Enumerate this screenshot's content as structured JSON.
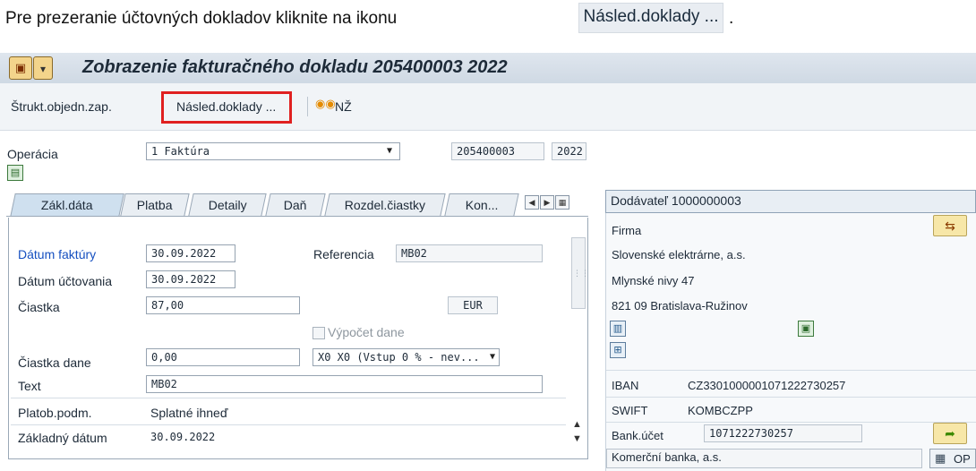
{
  "instruction": {
    "text": "Pre prezeranie účtovných dokladov kliknite na ikonu",
    "button_label": "Násled.doklady ...",
    "end": "."
  },
  "window": {
    "title": "Zobrazenie fakturačného dokladu 205400003 2022"
  },
  "toolbar": {
    "structure_label": "Štrukt.objedn.zap.",
    "follow_on_label": "Násled.doklady ...",
    "nz_label": "NŽ"
  },
  "header": {
    "operation_label": "Operácia",
    "operation_value": "1 Faktúra",
    "doc_number": "205400003",
    "year": "2022"
  },
  "tabs": [
    "Zákl.dáta",
    "Platba",
    "Detaily",
    "Daň",
    "Rozdel.čiastky",
    "Kon..."
  ],
  "basic": {
    "invoice_date_label": "Dátum faktúry",
    "invoice_date": "30.09.2022",
    "reference_label": "Referencia",
    "reference": "MB02",
    "posting_date_label": "Dátum účtovania",
    "posting_date": "30.09.2022",
    "amount_label": "Čiastka",
    "amount": "87,00",
    "currency": "EUR",
    "calc_tax_label": "Výpočet dane",
    "tax_amount_label": "Čiastka dane",
    "tax_amount": "0,00",
    "tax_code": "X0 X0 (Vstup 0 % - nev...",
    "text_label": "Text",
    "text": "MB02",
    "payment_terms_label": "Platob.podm.",
    "payment_terms": "Splatné ihneď",
    "baseline_date_label": "Základný dátum",
    "baseline_date": "30.09.2022"
  },
  "vendor": {
    "header": "Dodávateľ 1000000003",
    "firm_label": "Firma",
    "name": "Slovenské elektrárne, a.s.",
    "street": "Mlynské nivy 47",
    "city": "821 09 Bratislava-Ružinov",
    "iban_label": "IBAN",
    "iban": "CZ3301000001071222730257",
    "swift_label": "SWIFT",
    "swift": "KOMBCZPP",
    "bank_account_label": "Bank.účet",
    "bank_account": "1071222730257",
    "bank_name": "Komerční banka, a.s.",
    "op_label": "OP"
  }
}
